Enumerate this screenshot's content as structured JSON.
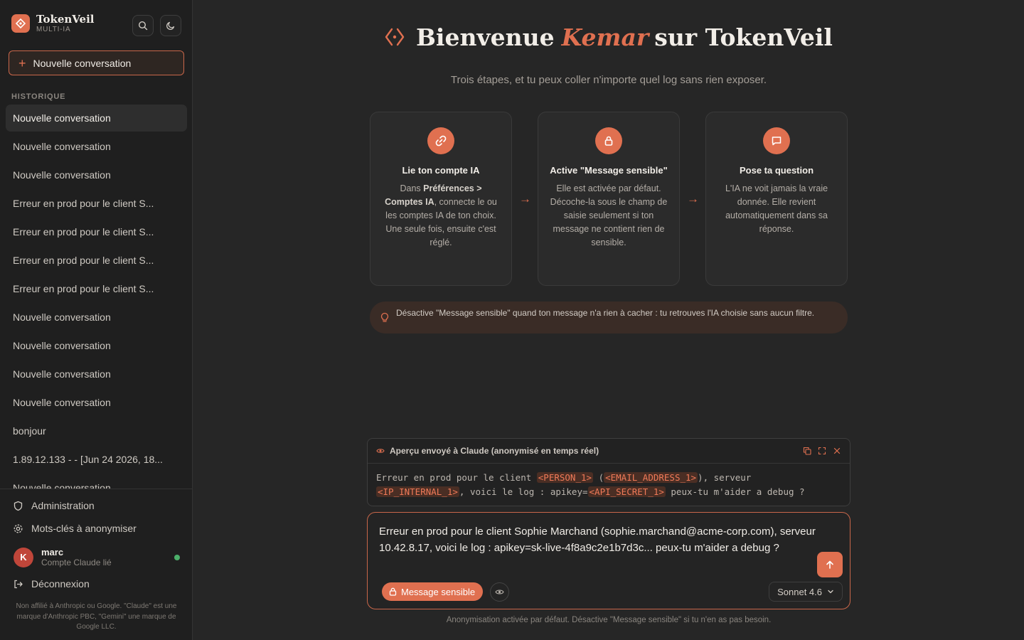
{
  "sidebar": {
    "brand_name": "TokenVeil",
    "brand_sub": "MULTI-IA",
    "new_conversation": "Nouvelle conversation",
    "history_label": "HISTORIQUE",
    "history": [
      "Nouvelle conversation",
      "Nouvelle conversation",
      "Nouvelle conversation",
      "Erreur en prod pour le client S...",
      "Erreur en prod pour le client S...",
      "Erreur en prod pour le client S...",
      "Erreur en prod pour le client S...",
      "Nouvelle conversation",
      "Nouvelle conversation",
      "Nouvelle conversation",
      "Nouvelle conversation",
      "bonjour",
      "1.89.12.133 - - [Jun 24 2026, 18...",
      "Nouvelle conversation"
    ],
    "admin": "Administration",
    "keywords": "Mots-clés à anonymiser",
    "user": {
      "initial": "K",
      "name": "marc",
      "sub": "Compte Claude lié"
    },
    "logout": "Déconnexion",
    "disclaimer": "Non affilié à Anthropic ou Google. \"Claude\" est une marque d'Anthropic PBC, \"Gemini\" une marque de Google LLC."
  },
  "hero": {
    "prefix": "Bienvenue",
    "name": "Kemar",
    "suffix": "sur TokenVeil",
    "subtitle": "Trois étapes, et tu peux coller n'importe quel log sans rien exposer."
  },
  "steps": [
    {
      "icon": "link-icon",
      "title": "Lie ton compte IA",
      "desc_pre": "Dans ",
      "desc_bold": "Préférences > Comptes IA",
      "desc_post": ", connecte le ou les comptes IA de ton choix. Une seule fois, ensuite c'est réglé."
    },
    {
      "icon": "lock-icon",
      "title": "Active \"Message sensible\"",
      "desc": "Elle est activée par défaut. Décoche-la sous le champ de saisie seulement si ton message ne contient rien de sensible."
    },
    {
      "icon": "chat-icon",
      "title": "Pose ta question",
      "desc": "L'IA ne voit jamais la vraie donnée. Elle revient automatiquement dans sa réponse."
    }
  ],
  "tip": "Désactive \"Message sensible\" quand ton message n'a rien à cacher : tu retrouves l'IA choisie sans aucun filtre.",
  "preview": {
    "title": "Aperçu envoyé à Claude (anonymisé en temps réel)",
    "t1": "Erreur en prod pour le client ",
    "tok1": "<PERSON_1>",
    "t2": " (",
    "tok2": "<EMAIL_ADDRESS_1>",
    "t3": "), serveur",
    "tok3": "<IP_INTERNAL_1>",
    "t4": ", voici le log : apikey=",
    "tok4": "<API_SECRET_1>",
    "t5": " peux-tu m'aider a debug ?"
  },
  "composer": {
    "text": "Erreur en prod pour le client Sophie Marchand (sophie.marchand@acme-corp.com), serveur 10.42.8.17, voici le log : apikey=sk-live-4f8a9c2e1b7d3c... peux-tu m'aider a debug ?",
    "sensitive_label": "Message sensible",
    "model": "Sonnet 4.6"
  },
  "footer_note": "Anonymisation activée par défaut. Désactive \"Message sensible\" si tu n'en as pas besoin.",
  "colors": {
    "accent": "#e07050",
    "background": "#262626",
    "sidebar": "#1f1f1f"
  }
}
